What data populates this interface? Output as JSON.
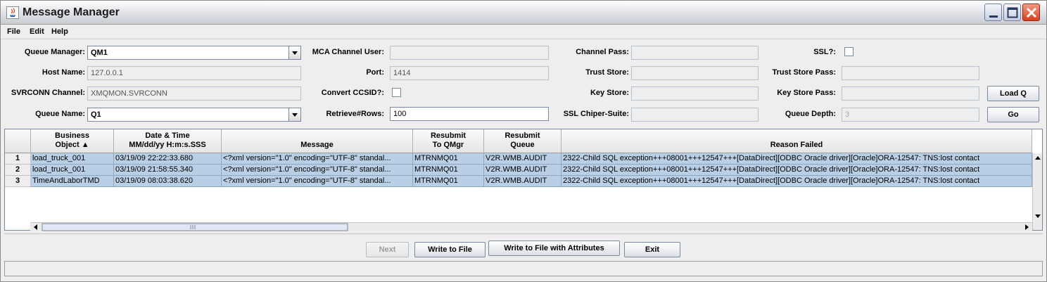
{
  "window": {
    "title": "Message Manager"
  },
  "menu": [
    "File",
    "Edit",
    "Help"
  ],
  "form": {
    "queue_manager_label": "Queue Manager:",
    "queue_manager_value": "QM1",
    "host_name_label": "Host Name:",
    "host_name_value": "127.0.0.1",
    "svrconn_label": "SVRCONN Channel:",
    "svrconn_value": "XMQMON.SVRCONN",
    "queue_name_label": "Queue Name:",
    "queue_name_value": "Q1",
    "mca_user_label": "MCA Channel User:",
    "mca_user_value": "",
    "port_label": "Port:",
    "port_value": "1414",
    "convert_ccsid_label": "Convert CCSID?:",
    "retrieve_rows_label": "Retrieve#Rows:",
    "retrieve_rows_value": "100",
    "channel_pass_label": "Channel Pass:",
    "trust_store_label": "Trust Store:",
    "key_store_label": "Key Store:",
    "ssl_cipher_label": "SSL Chiper-Suite:",
    "ssl_label": "SSL?:",
    "trust_store_pass_label": "Trust Store Pass:",
    "key_store_pass_label": "Key Store Pass:",
    "queue_depth_label": "Queue Depth:",
    "queue_depth_value": "3",
    "load_q_label": "Load Q",
    "go_label": "Go"
  },
  "table": {
    "headers": [
      [
        "Business",
        "Object ▲"
      ],
      [
        "Date & Time",
        "MM/dd/yy H:m:s.SSS"
      ],
      [
        "",
        "Message"
      ],
      [
        "Resubmit",
        "To QMgr"
      ],
      [
        "Resubmit",
        "Queue"
      ],
      [
        "",
        "Reason Failed"
      ]
    ],
    "rows": [
      {
        "num": "1",
        "cells": [
          "load_truck_001",
          "03/19/09 22:22:33.680",
          "<?xml version=\"1.0\" encoding=\"UTF-8\" standal...",
          "MTRNMQ01",
          "V2R.WMB.AUDIT",
          "2322-Child SQL exception+++08001+++12547+++[DataDirect][ODBC Oracle driver][Oracle]ORA-12547: TNS:lost contact"
        ]
      },
      {
        "num": "2",
        "cells": [
          "load_truck_001",
          "03/19/09 21:58:55.340",
          "<?xml version=\"1.0\" encoding=\"UTF-8\" standal...",
          "MTRNMQ01",
          "V2R.WMB.AUDIT",
          "2322-Child SQL exception+++08001+++12547+++[DataDirect][ODBC Oracle driver][Oracle]ORA-12547: TNS:lost contact"
        ]
      },
      {
        "num": "3",
        "cells": [
          "TimeAndLaborTMD",
          "03/19/09 08:03:38.620",
          "<?xml version=\"1.0\" encoding=\"UTF-8\" standal...",
          "MTRNMQ01",
          "V2R.WMB.AUDIT",
          "2322-Child SQL exception+++08001+++12547+++[DataDirect][ODBC Oracle driver][Oracle]ORA-12547: TNS:lost contact"
        ]
      }
    ]
  },
  "buttons": {
    "next": "Next",
    "write_to_file": "Write to File",
    "write_with_attrs": "Write to File with Attributes",
    "exit": "Exit"
  },
  "colors": {
    "row_selected": "#b8cfe5",
    "close_button": "#d4411f"
  }
}
